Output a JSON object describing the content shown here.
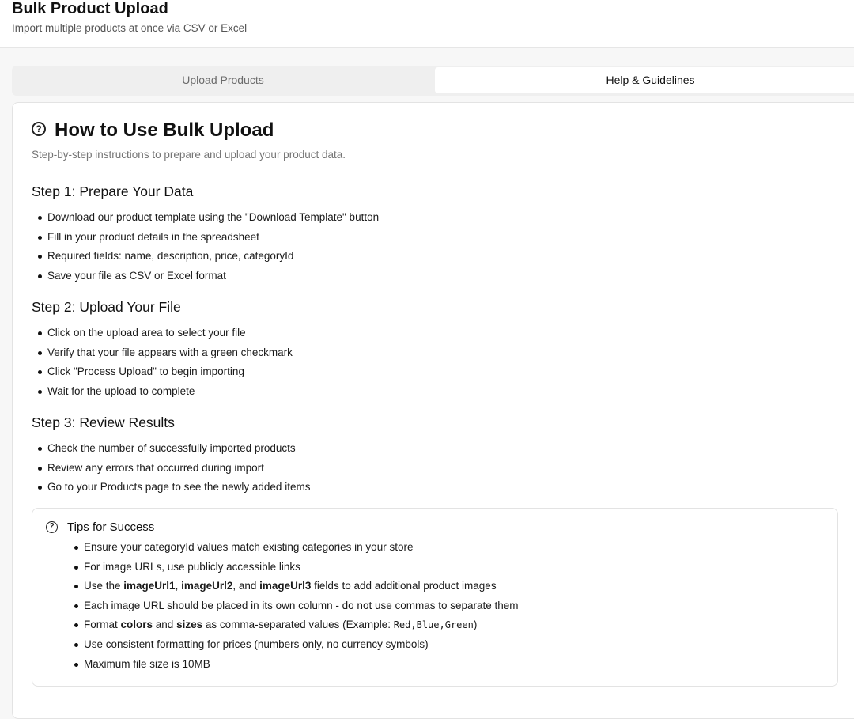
{
  "header": {
    "title": "Bulk Product Upload",
    "subtitle": "Import multiple products at once via CSV or Excel"
  },
  "tabs": [
    {
      "label": "Upload Products",
      "active": false
    },
    {
      "label": "Help & Guidelines",
      "active": true
    }
  ],
  "card": {
    "icon": "help-circle-icon",
    "title": "How to Use Bulk Upload",
    "description": "Step-by-step instructions to prepare and upload your product data."
  },
  "steps": [
    {
      "title": "Step 1: Prepare Your Data",
      "items": [
        "Download our product template using the \"Download Template\" button",
        "Fill in your product details in the spreadsheet",
        "Required fields: name, description, price, categoryId",
        "Save your file as CSV or Excel format"
      ]
    },
    {
      "title": "Step 2: Upload Your File",
      "items": [
        "Click on the upload area to select your file",
        "Verify that your file appears with a green checkmark",
        "Click \"Process Upload\" to begin importing",
        "Wait for the upload to complete"
      ]
    },
    {
      "title": "Step 3: Review Results",
      "items": [
        "Check the number of successfully imported products",
        "Review any errors that occurred during import",
        "Go to your Products page to see the newly added items"
      ]
    }
  ],
  "tips": {
    "icon": "help-circle-icon",
    "title": "Tips for Success",
    "item1": "Ensure your categoryId values match existing categories in your store",
    "item2": "For image URLs, use publicly accessible links",
    "item3": {
      "prefix": "Use the ",
      "field1": "imageUrl1",
      "sep1": ", ",
      "field2": "imageUrl2",
      "sep2": ", and ",
      "field3": "imageUrl3",
      "suffix": " fields to add additional product images"
    },
    "item4": "Each image URL should be placed in its own column - do not use commas to separate them",
    "item5": {
      "prefix": "Format ",
      "bold1": "colors",
      "mid": " and ",
      "bold2": "sizes",
      "text": " as comma-separated values (Example: ",
      "example": "Red,Blue,Green",
      "suffix": ")"
    },
    "item6": "Use consistent formatting for prices (numbers only, no currency symbols)",
    "item7": "Maximum file size is 10MB"
  }
}
